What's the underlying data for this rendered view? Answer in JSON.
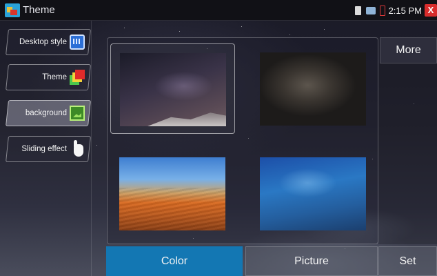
{
  "window": {
    "title": "Theme",
    "app_icon": "theme-app-icon"
  },
  "status_bar": {
    "time": "2:15 PM",
    "icons": [
      "sd-card-icon",
      "network-icon",
      "battery-icon"
    ],
    "close_label": "X"
  },
  "sidebar": {
    "items": [
      {
        "label": "Desktop style",
        "icon": "desktop-style-icon",
        "active": false
      },
      {
        "label": "Theme",
        "icon": "theme-icon",
        "active": false
      },
      {
        "label": "background",
        "icon": "background-icon",
        "active": true
      },
      {
        "label": "Sliding effect",
        "icon": "hand-icon",
        "active": false
      }
    ]
  },
  "wallpapers": [
    {
      "name": "starry-night-mountain",
      "selected": true
    },
    {
      "name": "dark-blur",
      "selected": false
    },
    {
      "name": "desert-dunes",
      "selected": false
    },
    {
      "name": "blue-gradient",
      "selected": false
    }
  ],
  "right_panel": {
    "more_label": "More"
  },
  "bottom_tabs": {
    "color_label": "Color",
    "picture_label": "Picture",
    "set_label": "Set",
    "active": "Color"
  },
  "colors": {
    "active_tab": "#1377b3",
    "close_button": "#d82c2c",
    "titlebar": "#111116"
  }
}
